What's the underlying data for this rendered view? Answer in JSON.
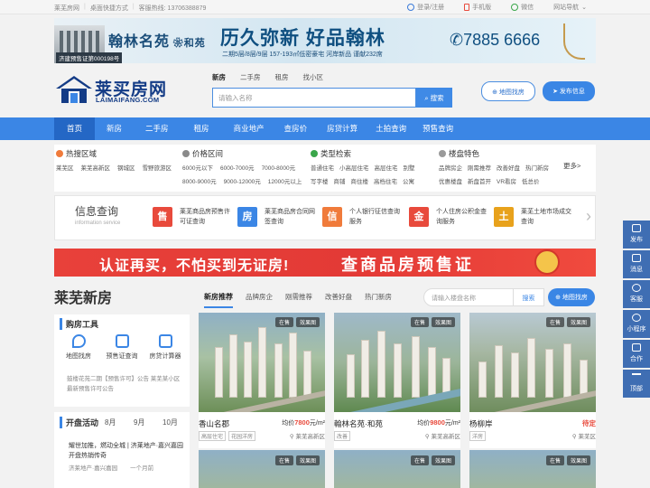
{
  "topbar": {
    "left": [
      "莱芜房网",
      "桌面快捷方式",
      "客服热线: 13706388879"
    ],
    "right": [
      "登录/注册",
      "手机版",
      "微信",
      "网站导航"
    ]
  },
  "banner": {
    "cert": "济建预售证第000198号",
    "brand": "翰林名苑",
    "brand_sub": "和苑",
    "slogan": "历久弥新 好品翰林",
    "sub": "二期5层/8层/9层 157-193㎡低密豪宅 河岸新品 谨献232席",
    "phone": "7885 6666"
  },
  "logo": {
    "name": "莱买房网",
    "en": "LAIMAIFANG.COM"
  },
  "search": {
    "tabs": [
      "新房",
      "二手房",
      "租房",
      "找小区"
    ],
    "placeholder": "请输入名称",
    "button": "搜索",
    "map_button": "地图找房",
    "publish_button": "发布信息"
  },
  "nav": [
    "首页",
    "新房",
    "二手房",
    "租房",
    "商业地产",
    "查房价",
    "房贷计算",
    "土拍查询",
    "预售查询"
  ],
  "categories": [
    {
      "title": "热搜区域",
      "color": "#f07b3b",
      "rows": [
        [
          "莱芜区",
          "莱芜高新区",
          "钢城区",
          "雪野旅游区"
        ]
      ]
    },
    {
      "title": "价格区间",
      "color": "#8a8a8a",
      "rows": [
        [
          "6000元以下",
          "6000-7000元",
          "7000-8000元"
        ],
        [
          "8000-9000元",
          "9000-12000元",
          "12000元以上"
        ]
      ]
    },
    {
      "title": "类型检索",
      "color": "#3aa64a",
      "rows": [
        [
          "普通住宅",
          "小高层住宅",
          "高层住宅",
          "别墅"
        ],
        [
          "写字楼",
          "商铺",
          "商住楼",
          "高档住宅",
          "公寓"
        ]
      ]
    },
    {
      "title": "楼盘特色",
      "color": "#9a9a9a",
      "rows": [
        [
          "品牌房企",
          "刚需推荐",
          "改善好盘",
          "热门新房"
        ],
        [
          "优惠楼盘",
          "新盘首开",
          "VR看房",
          "低总价"
        ]
      ]
    }
  ],
  "more": "更多>",
  "info": {
    "title": "信息查询",
    "title_en": "information service",
    "services": [
      {
        "badge": "售",
        "color": "#e84a3c",
        "text": "莱芜商品房预售许可证查询"
      },
      {
        "badge": "房",
        "color": "#3b86e5",
        "text": "莱芜商品房合同网签查询"
      },
      {
        "badge": "信",
        "color": "#f07b3b",
        "text": "个人银行征信查询服务"
      },
      {
        "badge": "金",
        "color": "#e84a3c",
        "text": "个人住房公积金查询服务"
      },
      {
        "badge": "土",
        "color": "#e8a21c",
        "text": "莱芜土地市场成交查询"
      }
    ]
  },
  "redbar": {
    "left": "认证再买，不怕买到无证房!",
    "right": "查商品房预售证"
  },
  "section": {
    "title": "莱芜新房",
    "tabs": [
      "新房推荐",
      "品牌房企",
      "刚需推荐",
      "改善好盘",
      "热门新房"
    ],
    "search_placeholder": "请输入楼盘名称",
    "search_button": "搜索",
    "map_button": "地图找房"
  },
  "tools": {
    "title": "购房工具",
    "items": [
      "地图找房",
      "预售证查询",
      "房贷计算器"
    ],
    "ticker": "鼓楼花苑二期【预售许可】公告  莱芜某小区最新预售许可公告"
  },
  "activity": {
    "title": "开盘活动",
    "months": [
      "8月",
      "9月",
      "10月"
    ],
    "text": "耀世加推，燃动全城 | 济莱地产·嘉兴嘉园开盘热销传奇",
    "meta": [
      "济莱地产·嘉兴嘉园",
      "一个月前"
    ]
  },
  "listings": [
    {
      "name": "香山名郡",
      "price_pre": "均价",
      "price": "7800",
      "unit": "元/m²",
      "labels": [
        "高层住宅",
        "花园洋房"
      ],
      "loc": "莱芜高新区",
      "tags": [
        "在售",
        "效果图"
      ]
    },
    {
      "name": "翰林名苑·和苑",
      "price_pre": "均价",
      "price": "9800",
      "unit": "元/m²",
      "labels": [
        "改善"
      ],
      "loc": "莱芜高新区",
      "tags": [
        "在售",
        "效果图"
      ]
    },
    {
      "name": "杨柳岸",
      "price_pre": "",
      "price": "待定",
      "unit": "",
      "labels": [
        "洋房"
      ],
      "loc": "莱芜区",
      "tags": [
        "在售",
        "效果图"
      ]
    }
  ],
  "second_row_tags": [
    [
      "在售",
      "效果图"
    ],
    [
      "在售",
      "效果图"
    ],
    [
      "在售",
      "效果图"
    ]
  ],
  "sidebar": [
    "发布",
    "消息",
    "客服",
    "小程序",
    "合作",
    "顶部"
  ]
}
